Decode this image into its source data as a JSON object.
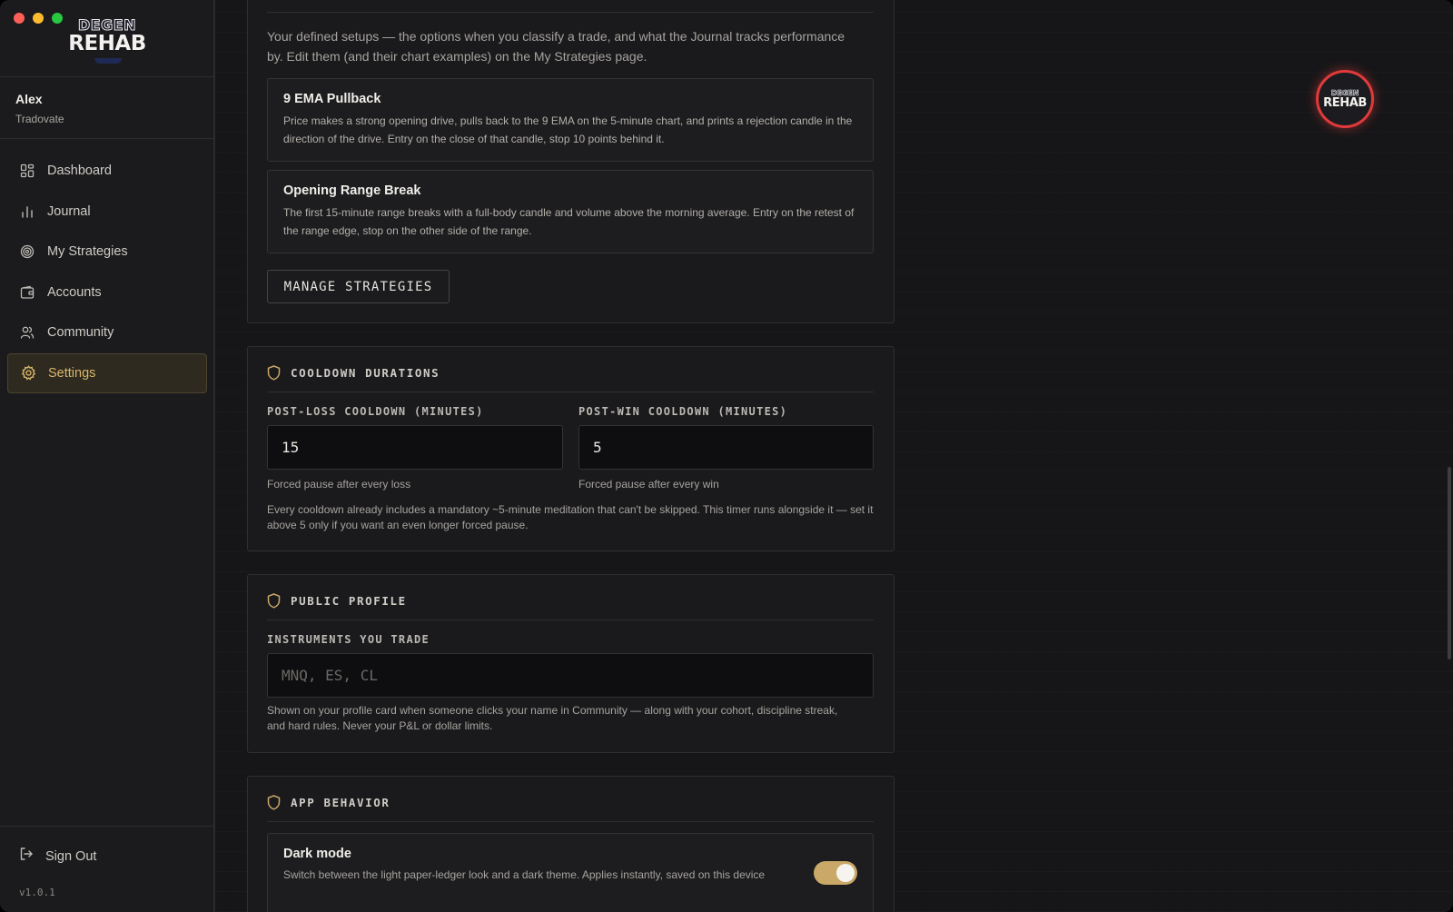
{
  "app": {
    "logo_top": "DEGEN",
    "logo_bottom": "REHAB",
    "version": "v1.0.1"
  },
  "user": {
    "name": "Alex",
    "broker": "Tradovate"
  },
  "sidebar": {
    "items": [
      {
        "label": "Dashboard",
        "icon": "grid-icon"
      },
      {
        "label": "Journal",
        "icon": "bar-chart-icon"
      },
      {
        "label": "My Strategies",
        "icon": "target-icon"
      },
      {
        "label": "Accounts",
        "icon": "wallet-icon"
      },
      {
        "label": "Community",
        "icon": "users-icon"
      },
      {
        "label": "Settings",
        "icon": "gear-icon",
        "active": true
      }
    ],
    "sign_out": "Sign Out"
  },
  "strategies_card": {
    "intro": "Your defined setups — the options when you classify a trade, and what the Journal tracks performance by. Edit them (and their chart examples) on the My Strategies page.",
    "items": [
      {
        "name": "9 EMA Pullback",
        "description": "Price makes a strong opening drive, pulls back to the 9 EMA on the 5-minute chart, and prints a rejection candle in the direction of the drive. Entry on the close of that candle, stop 10 points behind it."
      },
      {
        "name": "Opening Range Break",
        "description": "The first 15-minute range breaks with a full-body candle and volume above the morning average. Entry on the retest of the range edge, stop on the other side of the range."
      }
    ],
    "manage_button": "MANAGE STRATEGIES"
  },
  "cooldown_card": {
    "title": "COOLDOWN DURATIONS",
    "post_loss": {
      "label": "POST-LOSS COOLDOWN (MINUTES)",
      "value": "15",
      "help": "Forced pause after every loss"
    },
    "post_win": {
      "label": "POST-WIN COOLDOWN (MINUTES)",
      "value": "5",
      "help": "Forced pause after every win"
    },
    "note": "Every cooldown already includes a mandatory ~5-minute meditation that can't be skipped. This timer runs alongside it — set it above 5 only if you want an even longer forced pause."
  },
  "profile_card": {
    "title": "PUBLIC PROFILE",
    "instruments": {
      "label": "INSTRUMENTS YOU TRADE",
      "placeholder": "MNQ, ES, CL",
      "value": ""
    },
    "help": "Shown on your profile card when someone clicks your name in Community — along with your cohort, discipline streak, and hard rules. Never your P&L or dollar limits."
  },
  "behavior_card": {
    "title": "APP BEHAVIOR",
    "dark_mode": {
      "label": "Dark mode",
      "description": "Switch between the light paper-ledger look and a dark theme. Applies instantly, saved on this device",
      "enabled": true
    }
  },
  "fab": {
    "top": "DEGEN",
    "bottom": "REHAB"
  },
  "colors": {
    "accent": "#c9a868",
    "active_text": "#d8b66a",
    "fab_ring": "#e23a3a",
    "background": "#161618"
  }
}
